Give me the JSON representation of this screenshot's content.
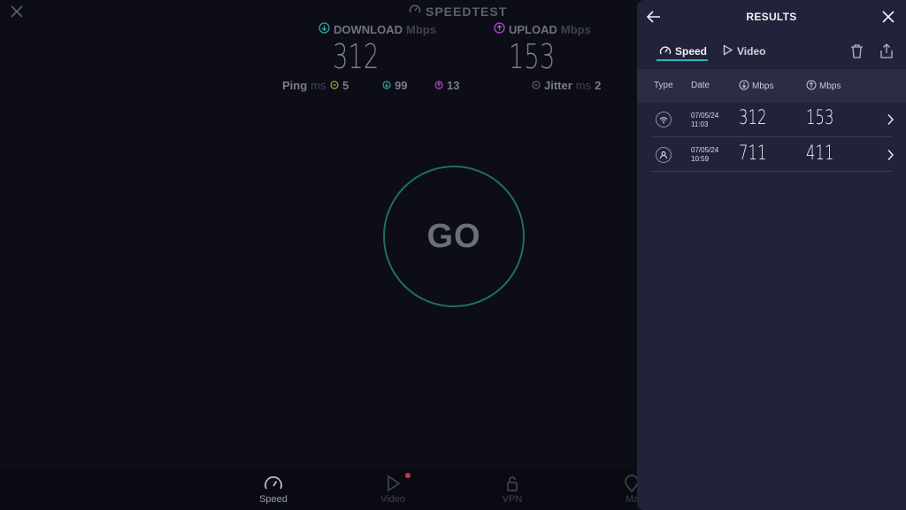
{
  "app": {
    "brand": "SPEEDTEST"
  },
  "metrics": {
    "download": {
      "label": "DOWNLOAD",
      "unit": "Mbps",
      "value": "312"
    },
    "upload": {
      "label": "UPLOAD",
      "unit": "Mbps",
      "value": "153"
    },
    "ping": {
      "label": "Ping",
      "unit": "ms",
      "idle": "5",
      "down": "99",
      "up": "13"
    },
    "jitter": {
      "label": "Jitter",
      "unit": "ms",
      "value": "2"
    }
  },
  "go_button": {
    "label": "GO"
  },
  "bottom_nav": {
    "items": [
      {
        "label": "Speed",
        "icon": "gauge-icon",
        "active": true
      },
      {
        "label": "Video",
        "icon": "play-icon",
        "active": false
      },
      {
        "label": "VPN",
        "icon": "lock-icon",
        "active": false
      },
      {
        "label": "Ma",
        "icon": "map-pin-icon",
        "active": false
      }
    ]
  },
  "results": {
    "title": "RESULTS",
    "tabs": [
      {
        "label": "Speed",
        "icon": "gauge-icon",
        "active": true
      },
      {
        "label": "Video",
        "icon": "play-icon",
        "active": false
      }
    ],
    "columns": {
      "type": "Type",
      "date": "Date",
      "download": "Mbps",
      "upload": "Mbps"
    },
    "rows": [
      {
        "type_icon": "wifi-icon",
        "date": "07/05/24",
        "time": "11:03",
        "download": "312",
        "upload": "153"
      },
      {
        "type_icon": "user-icon",
        "date": "07/05/24",
        "time": "10:59",
        "download": "711",
        "upload": "411"
      }
    ]
  },
  "colors": {
    "background": "#0c0d16",
    "panel": "#21233a",
    "accent": "#35b3c0",
    "download": "#2aa39a",
    "upload": "#b04cc8",
    "notification": "#d0304a"
  }
}
